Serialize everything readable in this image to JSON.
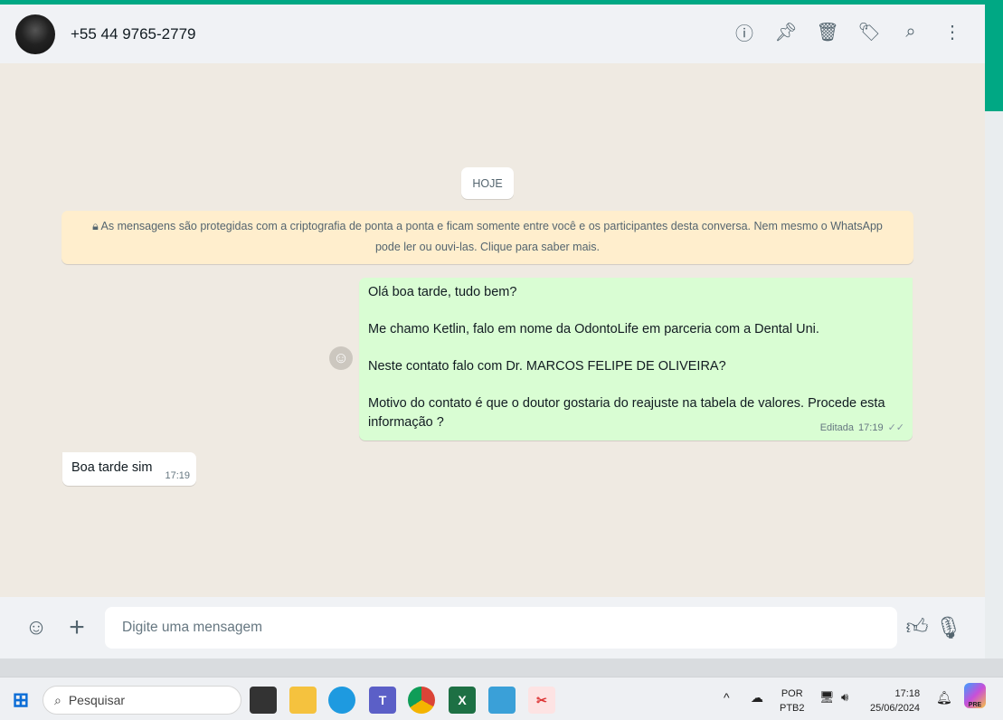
{
  "header": {
    "contact_name": "+55 44 9765-2779",
    "icons": [
      "info-icon",
      "pin-icon",
      "delete-icon",
      "label-icon",
      "search-icon",
      "menu-icon"
    ]
  },
  "chat": {
    "date_label": "HOJE",
    "encryption_notice": "As mensagens são protegidas com a criptografia de ponta a ponta e ficam somente entre você e os participantes desta conversa. Nem mesmo o WhatsApp pode ler ou ouvi-las. Clique para saber mais.",
    "messages": [
      {
        "direction": "outgoing",
        "paragraphs": [
          "Olá boa tarde, tudo bem?",
          "Me chamo Ketlin, falo em nome da OdontoLife em parceria com a Dental Uni.",
          "Neste contato falo com Dr. MARCOS FELIPE DE OLIVEIRA?",
          "Motivo do contato é que o doutor gostaria do reajuste na tabela de valores. Procede esta informação ?"
        ],
        "edited_label": "Editada",
        "time": "17:19",
        "status": "read"
      },
      {
        "direction": "incoming",
        "text": "Boa tarde sim",
        "time": "17:19"
      }
    ]
  },
  "composer": {
    "placeholder": "Digite uma mensagem"
  },
  "taskbar": {
    "search_label": "Pesquisar",
    "lang_top": "POR",
    "lang_bottom": "PTB2",
    "time": "17:18",
    "date": "25/06/2024",
    "copilot_badge": "PRE"
  },
  "colors": {
    "accent": "#00a884",
    "outgoing_bubble": "#d9fdd3",
    "notice": "#ffeecd",
    "chat_bg": "#efeae2"
  }
}
